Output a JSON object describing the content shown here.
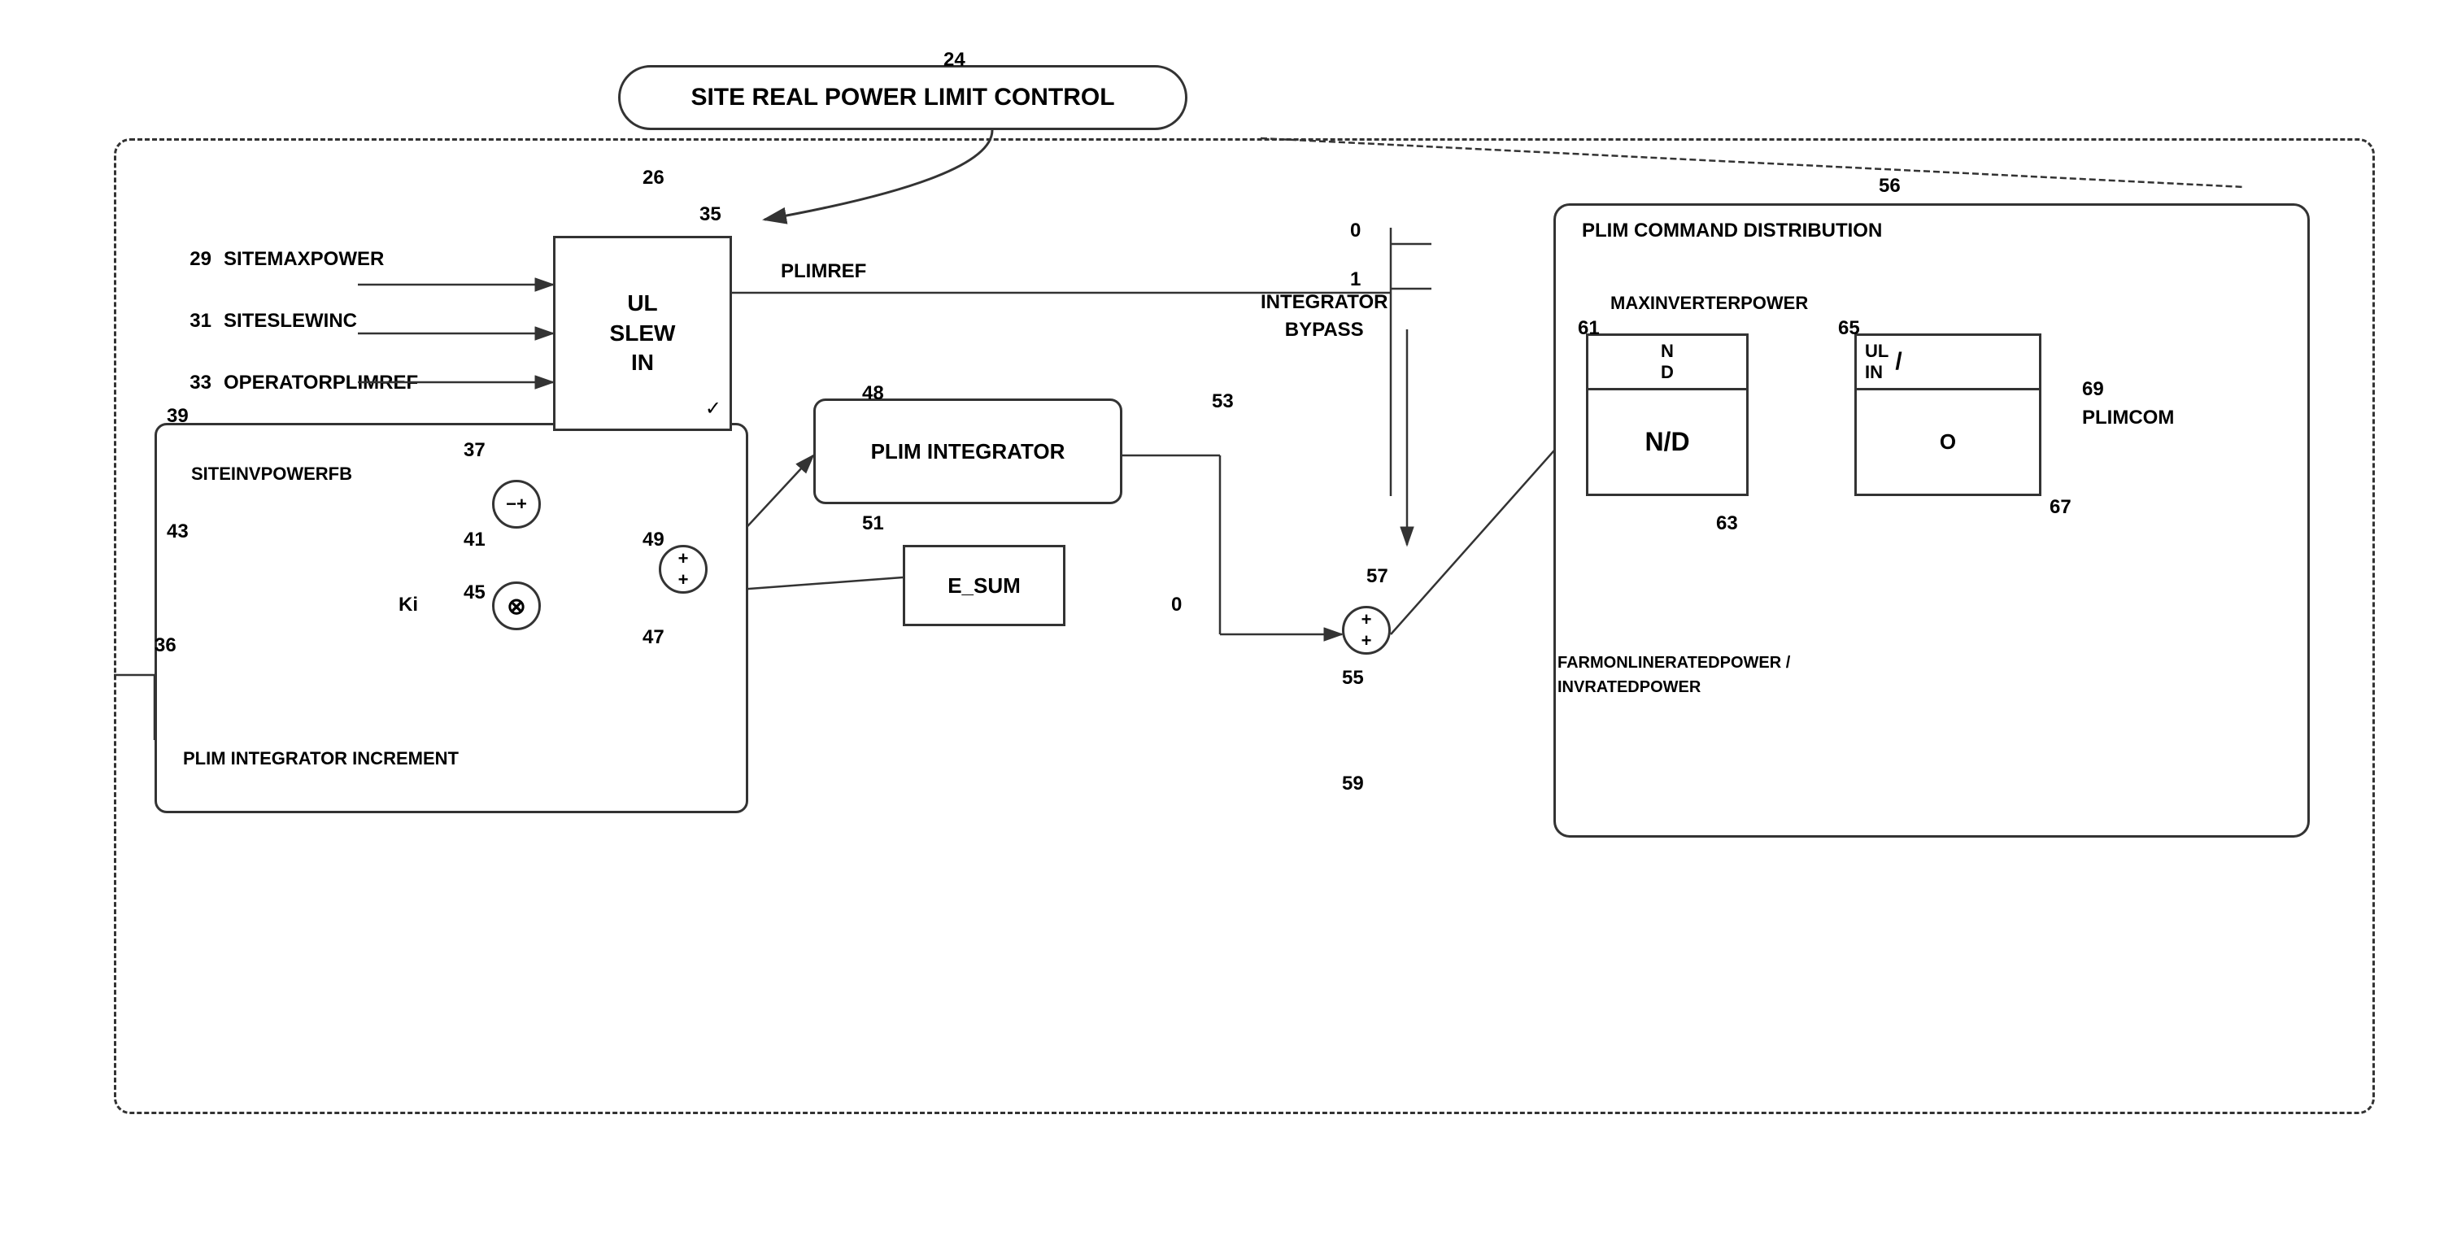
{
  "diagram": {
    "label_24": "24",
    "main_title": "SITE REAL POWER LIMIT CONTROL",
    "label_26": "26",
    "label_35": "35",
    "ul_slew_in": {
      "line1": "UL",
      "line2": "SLEW",
      "line3": "IN"
    },
    "plimref": "PLIMREF",
    "inputs": [
      {
        "num": "29",
        "text": "SITEMAXPOWER"
      },
      {
        "num": "31",
        "text": "SITESLEWINC"
      },
      {
        "num": "33",
        "text": "OPERATORPLIMREF"
      }
    ],
    "label_39": "39",
    "label_37": "37",
    "label_41": "41",
    "label_43": "43",
    "label_45": "45",
    "label_49": "49",
    "label_47": "47",
    "label_36": "36",
    "label_48": "48",
    "label_51": "51",
    "label_53": "53",
    "label_0_top": "0",
    "label_1": "1",
    "siteinvpowerfb": "SITEINVPOWERFB",
    "ki_label": "Ki",
    "plim_integrator_increment": "PLIM INTEGRATOR INCREMENT",
    "plim_integrator": "PLIM INTEGRATOR",
    "e_sum": "E_SUM",
    "minus_plus": "−+",
    "multiply": "⊗",
    "plus_plus_1": "++",
    "plus_plus_2": "++",
    "integrator_bypass": "INTEGRATOR\nBYPASS",
    "label_0_mid": "0",
    "label_55": "55",
    "label_57": "57",
    "label_56": "56",
    "label_59": "59",
    "plim_command_dist": "PLIM COMMAND DISTRIBUTION",
    "label_61": "61",
    "maxinverterpower": "MAXINVERTERPOWER",
    "nd_top": "N\nD",
    "nd_main": "N/D",
    "label_63": "63",
    "label_65": "65",
    "ul_in": "UL\nIN",
    "o_label": "O",
    "plimcom": "PLIMCOM",
    "label_69": "69",
    "label_67": "67",
    "farmonlineratedpower": "FARMONLINERATEDPOWER /\nINVRATEDPOWER"
  }
}
